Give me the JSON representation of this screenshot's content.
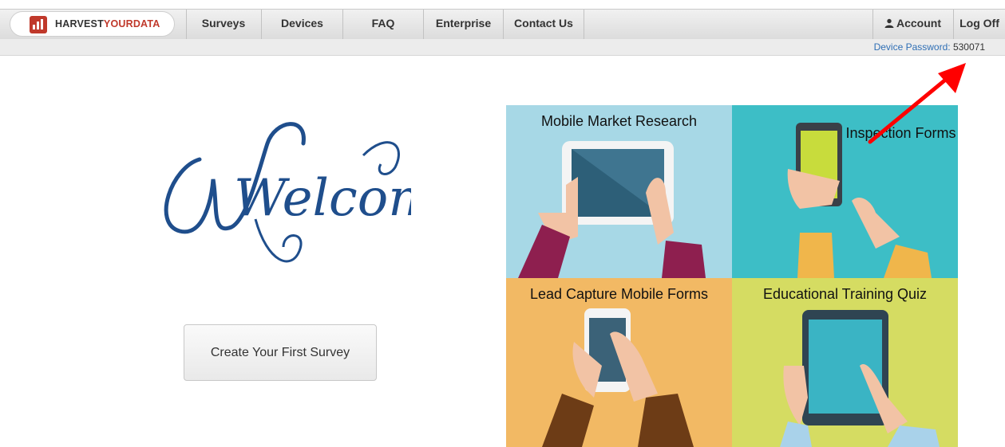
{
  "brand": {
    "name_part1": "HARVEST",
    "name_part2": "YOURDATA"
  },
  "nav": {
    "items": [
      "Surveys",
      "Devices",
      "FAQ",
      "Enterprise",
      "Contact Us"
    ],
    "account_label": "Account",
    "logoff_label": "Log Off"
  },
  "device_password": {
    "label": "Device Password:",
    "value": "530071"
  },
  "welcome_text": "Welcome",
  "create_button": "Create Your First Survey",
  "tiles": [
    {
      "title": "Mobile Market Research"
    },
    {
      "title": "Inspection Forms"
    },
    {
      "title": "Lead Capture Mobile Forms"
    },
    {
      "title": "Educational Training Quiz"
    }
  ],
  "colors": {
    "brand_red": "#c0392b",
    "link_blue": "#2f6fb5",
    "annotation_arrow": "#ff0000"
  }
}
